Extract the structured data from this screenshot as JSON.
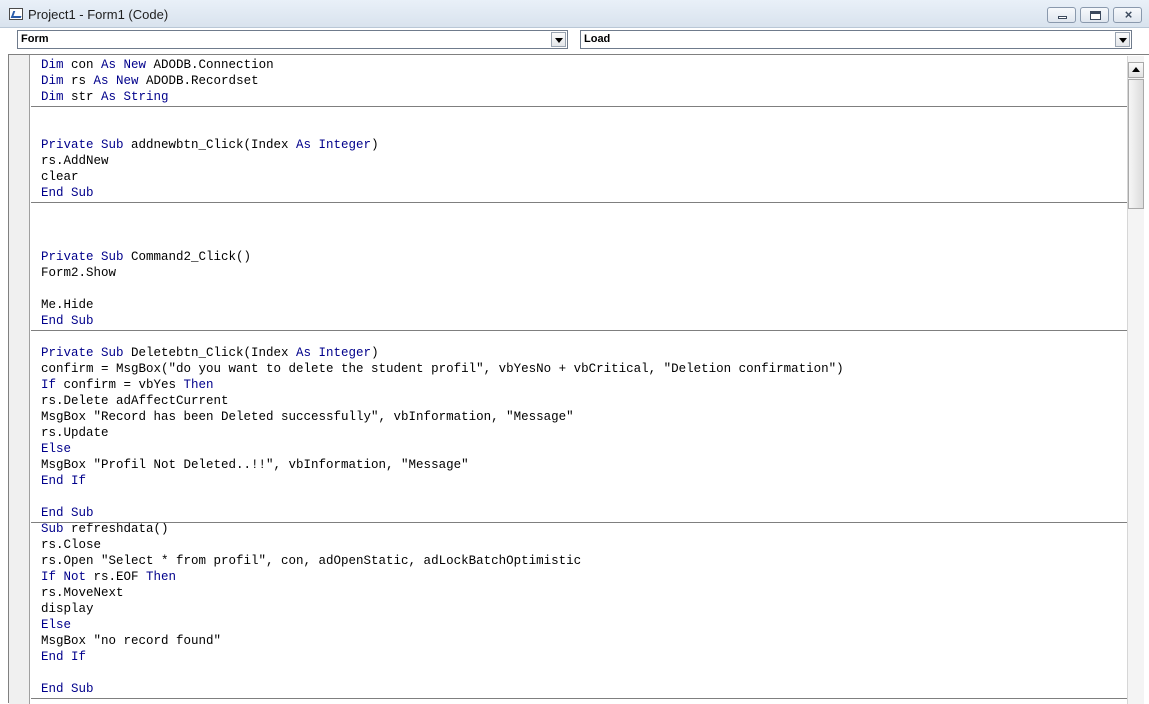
{
  "window": {
    "title": "Project1 - Form1 (Code)"
  },
  "object_combo": {
    "value": "Form"
  },
  "procedure_combo": {
    "value": "Load"
  },
  "code_lines": [
    [
      {
        "t": "Dim",
        "k": 1
      },
      {
        "t": " con "
      },
      {
        "t": "As New",
        "k": 1
      },
      {
        "t": " ADODB.Connection"
      }
    ],
    [
      {
        "t": "Dim",
        "k": 1
      },
      {
        "t": " rs "
      },
      {
        "t": "As New",
        "k": 1
      },
      {
        "t": " ADODB.Recordset"
      }
    ],
    [
      {
        "t": "Dim",
        "k": 1
      },
      {
        "t": " str "
      },
      {
        "t": "As String",
        "k": 1
      }
    ],
    null,
    null,
    [
      {
        "t": "Private Sub",
        "k": 1
      },
      {
        "t": " addnewbtn_Click(Index "
      },
      {
        "t": "As Integer",
        "k": 1
      },
      {
        "t": ")"
      }
    ],
    [
      {
        "t": "rs.AddNew"
      }
    ],
    [
      {
        "t": "clear"
      }
    ],
    [
      {
        "t": "End Sub",
        "k": 1
      }
    ],
    null,
    null,
    null,
    [
      {
        "t": "Private Sub",
        "k": 1
      },
      {
        "t": " Command2_Click()"
      }
    ],
    [
      {
        "t": "Form2.Show"
      }
    ],
    null,
    [
      {
        "t": "Me.Hide"
      }
    ],
    [
      {
        "t": "End Sub",
        "k": 1
      }
    ],
    null,
    [
      {
        "t": "Private Sub",
        "k": 1
      },
      {
        "t": " Deletebtn_Click(Index "
      },
      {
        "t": "As Integer",
        "k": 1
      },
      {
        "t": ")"
      }
    ],
    [
      {
        "t": "confirm = MsgBox(\"do you want to delete the student profil\", vbYesNo + vbCritical, \"Deletion confirmation\")"
      }
    ],
    [
      {
        "t": "If",
        "k": 1
      },
      {
        "t": " confirm = vbYes "
      },
      {
        "t": "Then",
        "k": 1
      }
    ],
    [
      {
        "t": "rs.Delete adAffectCurrent"
      }
    ],
    [
      {
        "t": "MsgBox \"Record has been Deleted successfully\", vbInformation, \"Message\""
      }
    ],
    [
      {
        "t": "rs.Update"
      }
    ],
    [
      {
        "t": "Else",
        "k": 1
      }
    ],
    [
      {
        "t": "MsgBox \"Profil Not Deleted..!!\", vbInformation, \"Message\""
      }
    ],
    [
      {
        "t": "End If",
        "k": 1
      }
    ],
    null,
    [
      {
        "t": "End Sub",
        "k": 1
      }
    ],
    [
      {
        "t": "Sub",
        "k": 1
      },
      {
        "t": " refreshdata()"
      }
    ],
    [
      {
        "t": "rs.Close"
      }
    ],
    [
      {
        "t": "rs.Open \"Select * from profil\", con, adOpenStatic, adLockBatchOptimistic"
      }
    ],
    [
      {
        "t": "If Not",
        "k": 1
      },
      {
        "t": " rs.EOF "
      },
      {
        "t": "Then",
        "k": 1
      }
    ],
    [
      {
        "t": "rs.MoveNext"
      }
    ],
    [
      {
        "t": "display"
      }
    ],
    [
      {
        "t": "Else",
        "k": 1
      }
    ],
    [
      {
        "t": "MsgBox \"no record found\""
      }
    ],
    [
      {
        "t": "End If",
        "k": 1
      }
    ],
    null,
    [
      {
        "t": "End Sub",
        "k": 1
      }
    ]
  ]
}
